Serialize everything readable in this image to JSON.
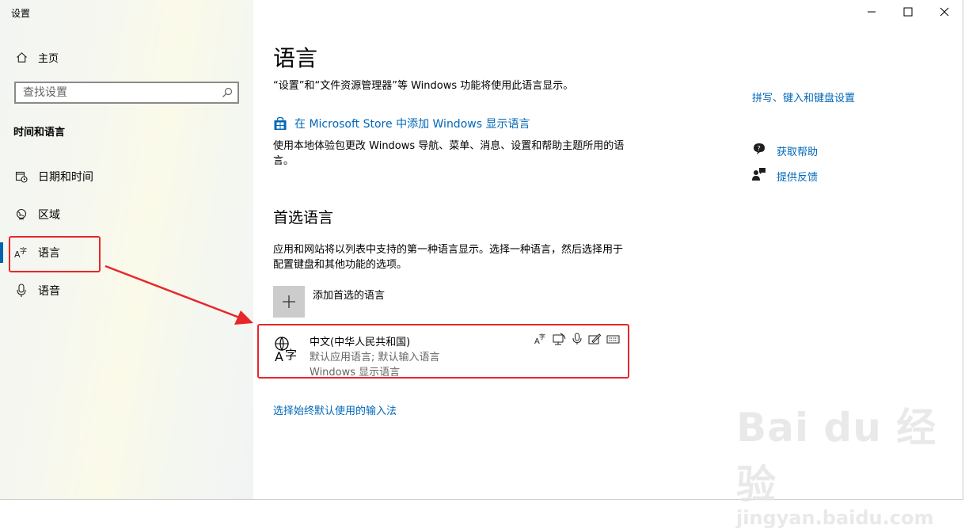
{
  "app_title": "设置",
  "window_controls": {
    "minimize": "—",
    "maximize": "☐",
    "close": "✕"
  },
  "sidebar": {
    "home": {
      "label": "主页",
      "icon": "home-icon"
    },
    "search": {
      "placeholder": "查找设置",
      "icon": "search-icon"
    },
    "section": "时间和语言",
    "items": [
      {
        "label": "日期和时间",
        "icon": "calendar-clock-icon"
      },
      {
        "label": "区域",
        "icon": "globe-region-icon"
      },
      {
        "label": "语言",
        "icon": "language-icon",
        "selected": true
      },
      {
        "label": "语音",
        "icon": "microphone-icon"
      }
    ]
  },
  "main": {
    "title": "语言",
    "intro": "“设置”和“文件资源管理器”等 Windows 功能将使用此语言显示。",
    "store_link": "在 Microsoft Store 中添加 Windows 显示语言",
    "store_desc": "使用本地体验包更改 Windows 导航、菜单、消息、设置和帮助主题所用的语言。",
    "preferred_heading": "首选语言",
    "preferred_desc": "应用和网站将以列表中支持的第一种语言显示。选择一种语言，然后选择用于配置键盘和其他功能的选项。",
    "add_language": "添加首选的语言",
    "language_entry": {
      "name": "中文(中华人民共和国)",
      "line1": "默认应用语言; 默认输入语言",
      "line2": "Windows 显示语言",
      "feature_icons": [
        "display-language-icon",
        "text-to-speech-icon",
        "speech-icon",
        "handwriting-icon",
        "keyboard-icon"
      ]
    },
    "input_method_link": "选择始终默认使用的输入法"
  },
  "right_rail": {
    "related_link": "拼写、键入和键盘设置",
    "help": "获取帮助",
    "feedback": "提供反馈"
  },
  "annotation": {
    "box_color": "#e8262a",
    "accent": "#0067b8"
  },
  "watermark": {
    "brand": "Bai du 经验",
    "url": "jingyan.baidu.com"
  }
}
